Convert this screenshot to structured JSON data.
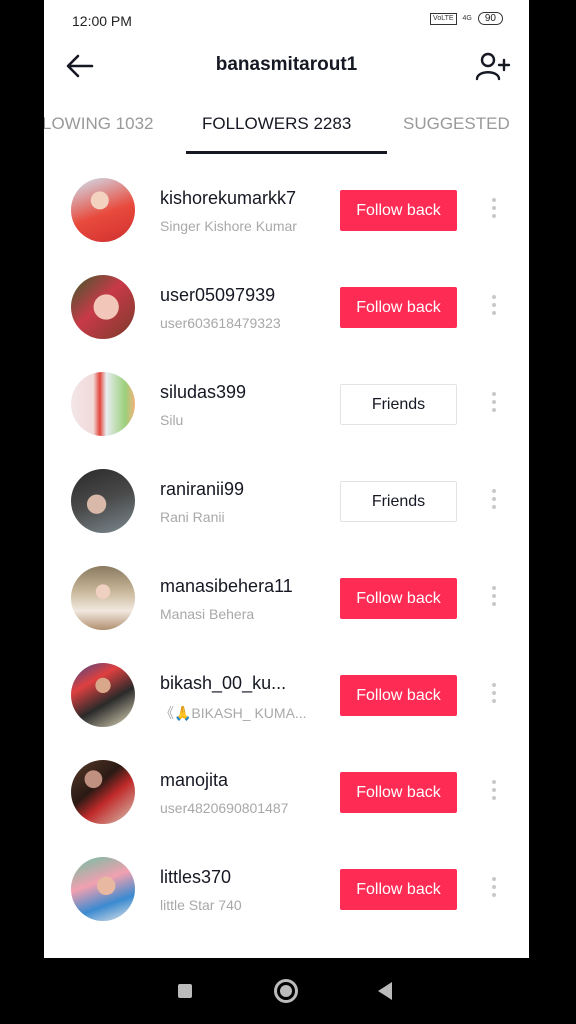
{
  "status_bar": {
    "time": "12:00 PM",
    "volte": "VoLTE",
    "network": "4G",
    "battery": "90"
  },
  "header": {
    "title": "banasmitarout1",
    "back_icon": "arrow-left-icon",
    "add_icon": "add-user-icon"
  },
  "tabs": [
    {
      "label": "LOWING 1032",
      "active": false
    },
    {
      "label": "FOLLOWERS 2283",
      "active": true
    },
    {
      "label": "SUGGESTED",
      "active": false
    }
  ],
  "colors": {
    "accent": "#fe2c55",
    "text": "#161823",
    "subtext": "#a8a8a8"
  },
  "followers": [
    {
      "username": "kishorekumarkk7",
      "nickname": "Singer Kishore Kumar",
      "button": "Follow back",
      "button_type": "follow"
    },
    {
      "username": "user05097939",
      "nickname": "user603618479323",
      "button": "Follow back",
      "button_type": "follow"
    },
    {
      "username": "siludas399",
      "nickname": "Silu",
      "button": "Friends",
      "button_type": "friends"
    },
    {
      "username": "raniranii99",
      "nickname": "Rani Ranii",
      "button": "Friends",
      "button_type": "friends"
    },
    {
      "username": "manasibehera11",
      "nickname": "Manasi Behera",
      "button": "Follow back",
      "button_type": "follow"
    },
    {
      "username": "bikash_00_ku...",
      "nickname": "《🙏BIKASH_ KUMA...",
      "button": "Follow back",
      "button_type": "follow"
    },
    {
      "username": "manojita",
      "nickname": "user4820690801487",
      "button": "Follow back",
      "button_type": "follow"
    },
    {
      "username": "littles370",
      "nickname": "little Star 740",
      "button": "Follow back",
      "button_type": "follow"
    }
  ]
}
